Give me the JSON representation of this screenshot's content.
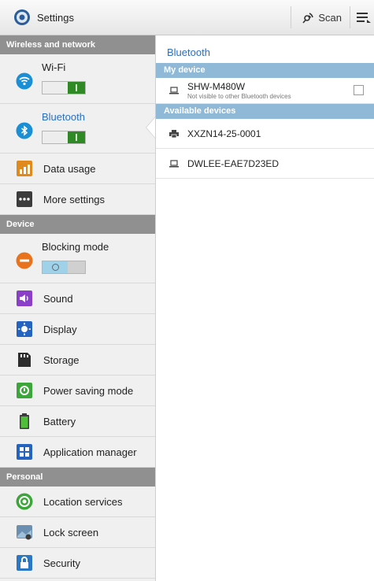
{
  "app": {
    "title": "Settings"
  },
  "actionbar": {
    "scan_label": "Scan"
  },
  "sections": {
    "wireless": "Wireless and network",
    "device": "Device",
    "personal": "Personal"
  },
  "left": {
    "wifi": "Wi-Fi",
    "bluetooth": "Bluetooth",
    "data_usage": "Data usage",
    "more_settings": "More settings",
    "blocking_mode": "Blocking mode",
    "sound": "Sound",
    "display": "Display",
    "storage": "Storage",
    "power_saving": "Power saving mode",
    "battery": "Battery",
    "app_manager": "Application manager",
    "location": "Location services",
    "lock_screen": "Lock screen",
    "security": "Security"
  },
  "toggles": {
    "wifi_on": true,
    "bluetooth_on": true,
    "blocking_on": false
  },
  "right": {
    "title": "Bluetooth",
    "my_device_header": "My device",
    "my_device_name": "SHW-M480W",
    "my_device_sub": "Not visible to other Bluetooth devices",
    "available_header": "Available devices",
    "devices": [
      "XXZN14-25-0001",
      "DWLEE-EAE7D23ED"
    ]
  },
  "colors": {
    "accent": "#2b6fbf",
    "section_bg": "#909090",
    "right_section_bg": "#8fb9d6",
    "toggle_on": "#2f8a26"
  }
}
